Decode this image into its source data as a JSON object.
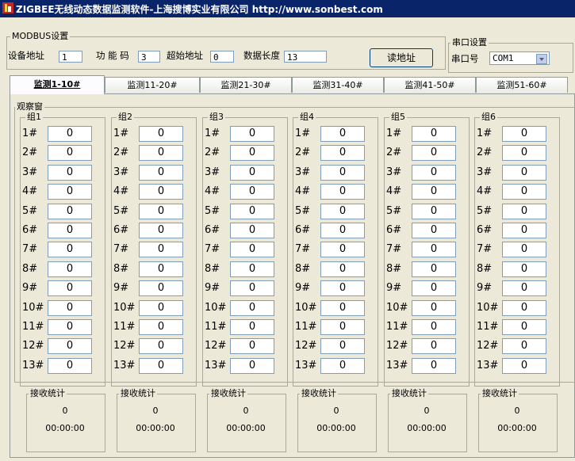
{
  "window": {
    "title": "ZIGBEE无线动态数据监测软件-上海搜博实业有限公司 http://www.sonbest.com"
  },
  "modbus": {
    "legend": "MODBUS设置",
    "device_addr_label": "设备地址",
    "device_addr_value": "1",
    "func_label": "功 能 码",
    "func_value": "3",
    "start_label": "超始地址",
    "start_value": "0",
    "length_label": "数据长度",
    "length_value": "13",
    "read_button": "读地址"
  },
  "serial": {
    "legend": "串口设置",
    "port_label": "串口号",
    "port_value": "COM1"
  },
  "tabs": [
    {
      "label": "监测1-10#"
    },
    {
      "label": "监测11-20#"
    },
    {
      "label": "监测21-30#"
    },
    {
      "label": "监测31-40#"
    },
    {
      "label": "监测41-50#"
    },
    {
      "label": "监测51-60#"
    }
  ],
  "observer": {
    "legend": "观察窗"
  },
  "groups": [
    {
      "title": "组1",
      "stat_legend": "接收统计",
      "count": "0",
      "time": "00:00:00"
    },
    {
      "title": "组2",
      "stat_legend": "接收统计",
      "count": "0",
      "time": "00:00:00"
    },
    {
      "title": "组3",
      "stat_legend": "接收统计",
      "count": "0",
      "time": "00:00:00"
    },
    {
      "title": "组4",
      "stat_legend": "接收统计",
      "count": "0",
      "time": "00:00:00"
    },
    {
      "title": "组5",
      "stat_legend": "接收统计",
      "count": "0",
      "time": "00:00:00"
    },
    {
      "title": "组6",
      "stat_legend": "接收统计",
      "count": "0",
      "time": "00:00:00"
    }
  ],
  "row_labels": [
    "1#",
    "2#",
    "3#",
    "4#",
    "5#",
    "6#",
    "7#",
    "8#",
    "9#",
    "10#",
    "11#",
    "12#",
    "13#"
  ],
  "row_values": [
    [
      "0",
      "0",
      "0",
      "0",
      "0",
      "0",
      "0",
      "0",
      "0",
      "0",
      "0",
      "0",
      "0"
    ],
    [
      "0",
      "0",
      "0",
      "0",
      "0",
      "0",
      "0",
      "0",
      "0",
      "0",
      "0",
      "0",
      "0"
    ],
    [
      "0",
      "0",
      "0",
      "0",
      "0",
      "0",
      "0",
      "0",
      "0",
      "0",
      "0",
      "0",
      "0"
    ],
    [
      "0",
      "0",
      "0",
      "0",
      "0",
      "0",
      "0",
      "0",
      "0",
      "0",
      "0",
      "0",
      "0"
    ],
    [
      "0",
      "0",
      "0",
      "0",
      "0",
      "0",
      "0",
      "0",
      "0",
      "0",
      "0",
      "0",
      "0"
    ],
    [
      "0",
      "0",
      "0",
      "0",
      "0",
      "0",
      "0",
      "0",
      "0",
      "0",
      "0",
      "0",
      "0"
    ]
  ]
}
